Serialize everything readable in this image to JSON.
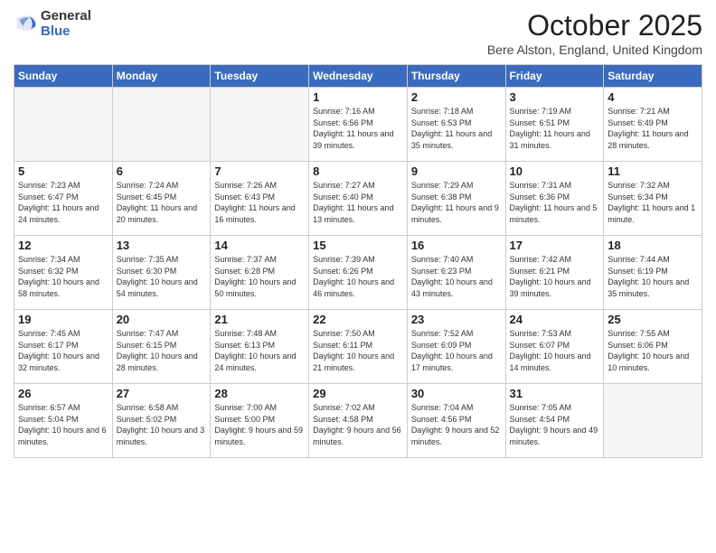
{
  "logo": {
    "general": "General",
    "blue": "Blue"
  },
  "header": {
    "month": "October 2025",
    "location": "Bere Alston, England, United Kingdom"
  },
  "days_of_week": [
    "Sunday",
    "Monday",
    "Tuesday",
    "Wednesday",
    "Thursday",
    "Friday",
    "Saturday"
  ],
  "weeks": [
    [
      {
        "day": "",
        "info": ""
      },
      {
        "day": "",
        "info": ""
      },
      {
        "day": "",
        "info": ""
      },
      {
        "day": "1",
        "info": "Sunrise: 7:16 AM\nSunset: 6:56 PM\nDaylight: 11 hours and 39 minutes."
      },
      {
        "day": "2",
        "info": "Sunrise: 7:18 AM\nSunset: 6:53 PM\nDaylight: 11 hours and 35 minutes."
      },
      {
        "day": "3",
        "info": "Sunrise: 7:19 AM\nSunset: 6:51 PM\nDaylight: 11 hours and 31 minutes."
      },
      {
        "day": "4",
        "info": "Sunrise: 7:21 AM\nSunset: 6:49 PM\nDaylight: 11 hours and 28 minutes."
      }
    ],
    [
      {
        "day": "5",
        "info": "Sunrise: 7:23 AM\nSunset: 6:47 PM\nDaylight: 11 hours and 24 minutes."
      },
      {
        "day": "6",
        "info": "Sunrise: 7:24 AM\nSunset: 6:45 PM\nDaylight: 11 hours and 20 minutes."
      },
      {
        "day": "7",
        "info": "Sunrise: 7:26 AM\nSunset: 6:43 PM\nDaylight: 11 hours and 16 minutes."
      },
      {
        "day": "8",
        "info": "Sunrise: 7:27 AM\nSunset: 6:40 PM\nDaylight: 11 hours and 13 minutes."
      },
      {
        "day": "9",
        "info": "Sunrise: 7:29 AM\nSunset: 6:38 PM\nDaylight: 11 hours and 9 minutes."
      },
      {
        "day": "10",
        "info": "Sunrise: 7:31 AM\nSunset: 6:36 PM\nDaylight: 11 hours and 5 minutes."
      },
      {
        "day": "11",
        "info": "Sunrise: 7:32 AM\nSunset: 6:34 PM\nDaylight: 11 hours and 1 minute."
      }
    ],
    [
      {
        "day": "12",
        "info": "Sunrise: 7:34 AM\nSunset: 6:32 PM\nDaylight: 10 hours and 58 minutes."
      },
      {
        "day": "13",
        "info": "Sunrise: 7:35 AM\nSunset: 6:30 PM\nDaylight: 10 hours and 54 minutes."
      },
      {
        "day": "14",
        "info": "Sunrise: 7:37 AM\nSunset: 6:28 PM\nDaylight: 10 hours and 50 minutes."
      },
      {
        "day": "15",
        "info": "Sunrise: 7:39 AM\nSunset: 6:26 PM\nDaylight: 10 hours and 46 minutes."
      },
      {
        "day": "16",
        "info": "Sunrise: 7:40 AM\nSunset: 6:23 PM\nDaylight: 10 hours and 43 minutes."
      },
      {
        "day": "17",
        "info": "Sunrise: 7:42 AM\nSunset: 6:21 PM\nDaylight: 10 hours and 39 minutes."
      },
      {
        "day": "18",
        "info": "Sunrise: 7:44 AM\nSunset: 6:19 PM\nDaylight: 10 hours and 35 minutes."
      }
    ],
    [
      {
        "day": "19",
        "info": "Sunrise: 7:45 AM\nSunset: 6:17 PM\nDaylight: 10 hours and 32 minutes."
      },
      {
        "day": "20",
        "info": "Sunrise: 7:47 AM\nSunset: 6:15 PM\nDaylight: 10 hours and 28 minutes."
      },
      {
        "day": "21",
        "info": "Sunrise: 7:48 AM\nSunset: 6:13 PM\nDaylight: 10 hours and 24 minutes."
      },
      {
        "day": "22",
        "info": "Sunrise: 7:50 AM\nSunset: 6:11 PM\nDaylight: 10 hours and 21 minutes."
      },
      {
        "day": "23",
        "info": "Sunrise: 7:52 AM\nSunset: 6:09 PM\nDaylight: 10 hours and 17 minutes."
      },
      {
        "day": "24",
        "info": "Sunrise: 7:53 AM\nSunset: 6:07 PM\nDaylight: 10 hours and 14 minutes."
      },
      {
        "day": "25",
        "info": "Sunrise: 7:55 AM\nSunset: 6:06 PM\nDaylight: 10 hours and 10 minutes."
      }
    ],
    [
      {
        "day": "26",
        "info": "Sunrise: 6:57 AM\nSunset: 5:04 PM\nDaylight: 10 hours and 6 minutes."
      },
      {
        "day": "27",
        "info": "Sunrise: 6:58 AM\nSunset: 5:02 PM\nDaylight: 10 hours and 3 minutes."
      },
      {
        "day": "28",
        "info": "Sunrise: 7:00 AM\nSunset: 5:00 PM\nDaylight: 9 hours and 59 minutes."
      },
      {
        "day": "29",
        "info": "Sunrise: 7:02 AM\nSunset: 4:58 PM\nDaylight: 9 hours and 56 minutes."
      },
      {
        "day": "30",
        "info": "Sunrise: 7:04 AM\nSunset: 4:56 PM\nDaylight: 9 hours and 52 minutes."
      },
      {
        "day": "31",
        "info": "Sunrise: 7:05 AM\nSunset: 4:54 PM\nDaylight: 9 hours and 49 minutes."
      },
      {
        "day": "",
        "info": ""
      }
    ]
  ]
}
